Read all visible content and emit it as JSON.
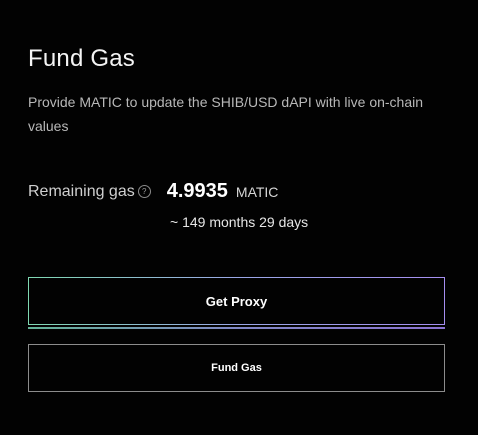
{
  "panel": {
    "title": "Fund Gas",
    "description": "Provide MATIC to update the SHIB/USD dAPI with live on-chain values"
  },
  "gas": {
    "label": "Remaining gas",
    "info_icon": "info-circle-icon",
    "amount": "4.9935",
    "unit": "MATIC",
    "duration": "~ 149 months 29 days"
  },
  "buttons": {
    "get_proxy_label": "Get Proxy",
    "fund_gas_label": "Fund Gas"
  },
  "colors": {
    "background": "#020202",
    "text": "#ffffff",
    "muted_text": "#b8b8b8",
    "gradient_start": "#7fd8b2",
    "gradient_end": "#a58ef0",
    "secondary_border": "#8c8c8c"
  }
}
